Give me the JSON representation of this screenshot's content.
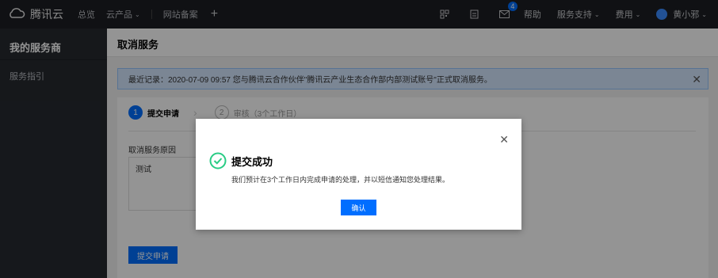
{
  "topbar": {
    "brand": "腾讯云",
    "nav": [
      "总览",
      "云产品"
    ],
    "site_record": "网站备案",
    "plus": "+",
    "mail_badge": "4",
    "help": "帮助",
    "support": "服务支持",
    "billing": "费用",
    "user": "黄小邪"
  },
  "sidebar": {
    "title": "我的服务商",
    "items": [
      "服务指引"
    ]
  },
  "content": {
    "title": "取消服务",
    "notice": "最近记录：2020-07-09 09:57 您与腾讯云合作伙伴\"腾讯云产业生态合作部内部测试账号\"正式取消服务。",
    "steps": [
      {
        "num": "1",
        "label": "提交申请"
      },
      {
        "num": "2",
        "label": "审核（3个工作日）"
      }
    ],
    "reason_label": "取消服务原因",
    "reason_value": "测试",
    "submit_label": "提交申请"
  },
  "dialog": {
    "title": "提交成功",
    "message": "我们预计在3个工作日内完成申请的处理，并以短信通知您处理结果。",
    "confirm_label": "确认"
  },
  "colors": {
    "accent": "#006eff",
    "success": "#29cc85",
    "topbar": "#1c1e24",
    "sidebar": "#262a30"
  },
  "icons": [
    "cloud-logo-icon",
    "chevron-down-icon",
    "qr-icon",
    "doc-icon",
    "mail-icon",
    "close-icon",
    "success-check-icon"
  ]
}
